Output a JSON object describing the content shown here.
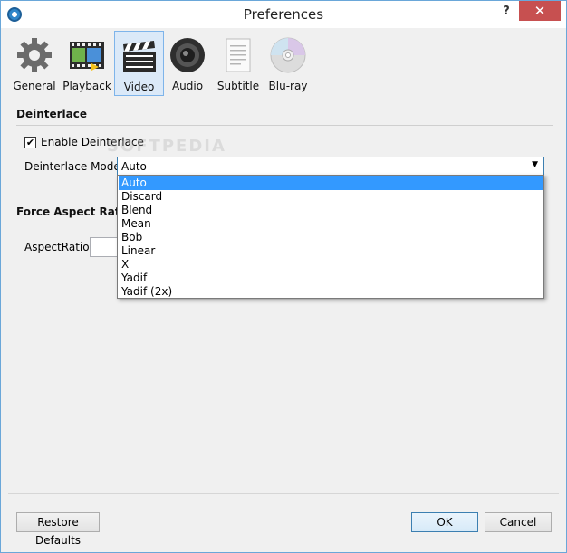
{
  "window": {
    "title": "Preferences",
    "help": "?",
    "close": "✕"
  },
  "toolbar": {
    "items": [
      {
        "label": "General",
        "icon": "gear-icon"
      },
      {
        "label": "Playback",
        "icon": "film-strip-icon"
      },
      {
        "label": "Video",
        "icon": "clapperboard-icon",
        "active": true
      },
      {
        "label": "Audio",
        "icon": "speaker-icon"
      },
      {
        "label": "Subtitle",
        "icon": "document-icon"
      },
      {
        "label": "Blu-ray",
        "icon": "disc-icon"
      }
    ]
  },
  "deinterlace": {
    "section_title": "Deinterlace",
    "enable_label": "Enable Deinterlace",
    "enable_checked": true,
    "mode_label": "Deinterlace Mode:",
    "mode_value": "Auto",
    "options": [
      "Auto",
      "Discard",
      "Blend",
      "Mean",
      "Bob",
      "Linear",
      "X",
      "Yadif",
      "Yadif (2x)"
    ],
    "selected_index": 0
  },
  "aspect": {
    "section_title": "Force Aspect Ratio",
    "label": "AspectRatio:",
    "value": ""
  },
  "footer": {
    "restore_label": "Restore Defaults",
    "ok_label": "OK",
    "cancel_label": "Cancel"
  },
  "watermark": "SOFTPEDIA"
}
